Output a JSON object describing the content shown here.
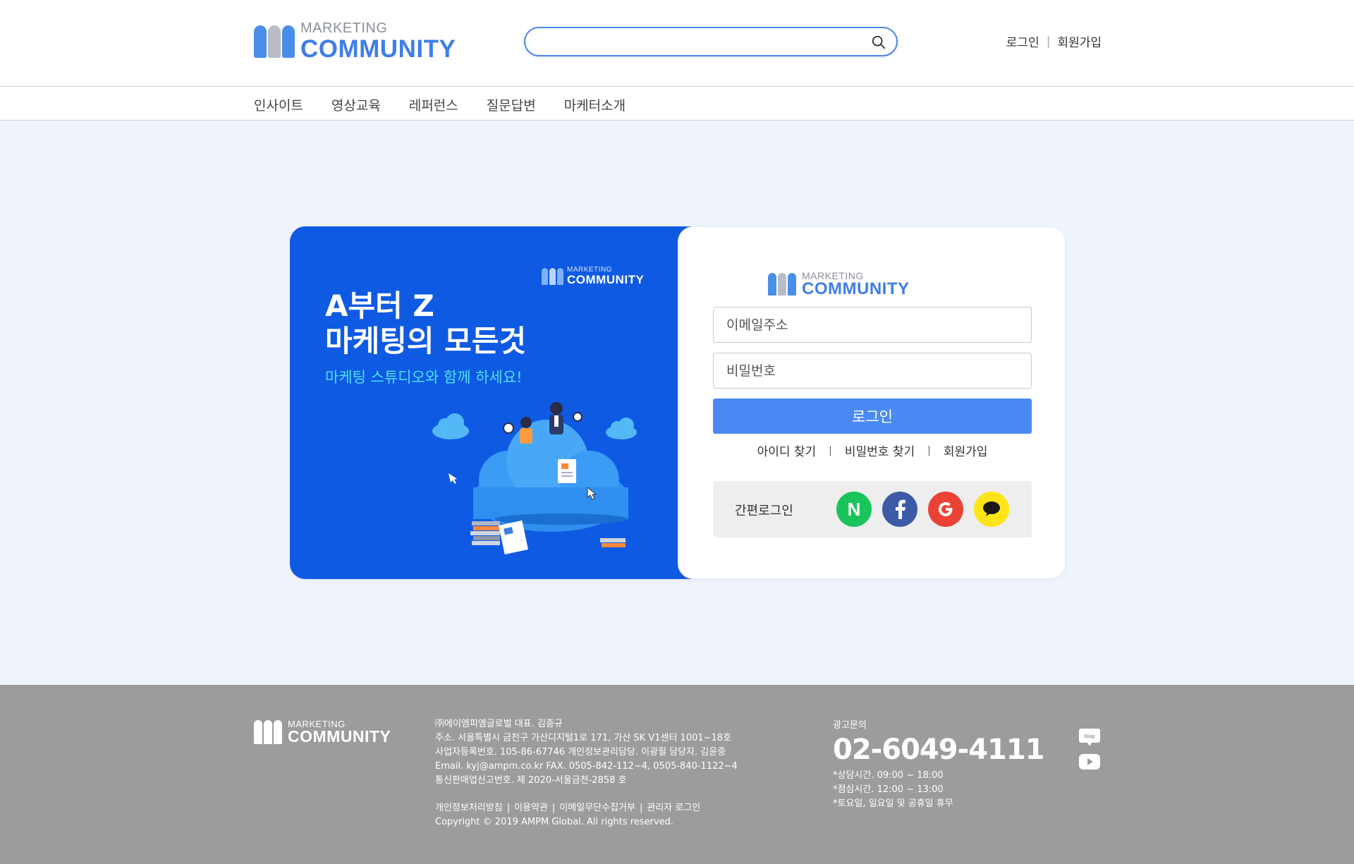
{
  "brand": {
    "small": "MARKETING",
    "big": "COMMUNITY",
    "mark_colors": [
      "#4a8ee8",
      "#b7bcc6",
      "#4a8ee8"
    ]
  },
  "header": {
    "search_placeholder": "",
    "links": {
      "login": "로그인",
      "signup": "회원가입"
    }
  },
  "nav": {
    "items": [
      "인사이트",
      "영상교육",
      "레퍼런스",
      "질문답변",
      "마케터소개"
    ]
  },
  "promo": {
    "title_line1": "A부터 Z",
    "title_line2": "마케팅의 모든것",
    "subtitle": "마케팅 스튜디오와 함께 하세요!"
  },
  "login_form": {
    "email_placeholder": "이메일주소",
    "password_placeholder": "비밀번호",
    "login_button": "로그인",
    "links": {
      "find_id": "아이디 찾기",
      "find_password": "비밀번호 찾기",
      "signup": "회원가입"
    },
    "social_label": "간편로그인",
    "social_naver_text": "N"
  },
  "footer": {
    "company": {
      "line1": "㈜에이엠피엠글로벌  대표. 김종규",
      "line2": "주소. 서울특별시 금천구 가산디지털1로 171, 가산 SK V1센터 1001~18호",
      "line3": "사업자등록번호. 105-86-67746  개인정보관리담당. 이광필  담당자. 김윤중",
      "line4": "Email. kyj@ampm.co.kr  FAX. 0505-842-112~4, 0505-840-1122~4",
      "line5": "통신판매업신고번호. 제 2020-서울금천-2858 호"
    },
    "links": {
      "privacy": "개인정보처리방침",
      "terms": "이용약관",
      "no_email": "이메일무단수집거부",
      "admin": "관리자 로그인"
    },
    "copyright": "Copyright © 2019 AMPM Global. All rights reserved.",
    "contact": {
      "label": "광고문의",
      "phone": "02-6049-4111",
      "hours1": "*상담시간. 09:00 ~ 18:00",
      "hours2": "*점심시간. 12:00 ~ 13:00",
      "hours3": "*토요일, 일요일 및 공휴일 휴무"
    },
    "sns_blog_text": "blog"
  },
  "colors": {
    "primary": "#0f5ae3",
    "button": "#4a8af5",
    "accent_text": "#4ee0f4",
    "footer_bg": "#9c9c9c",
    "page_bg": "#eff3fb"
  }
}
